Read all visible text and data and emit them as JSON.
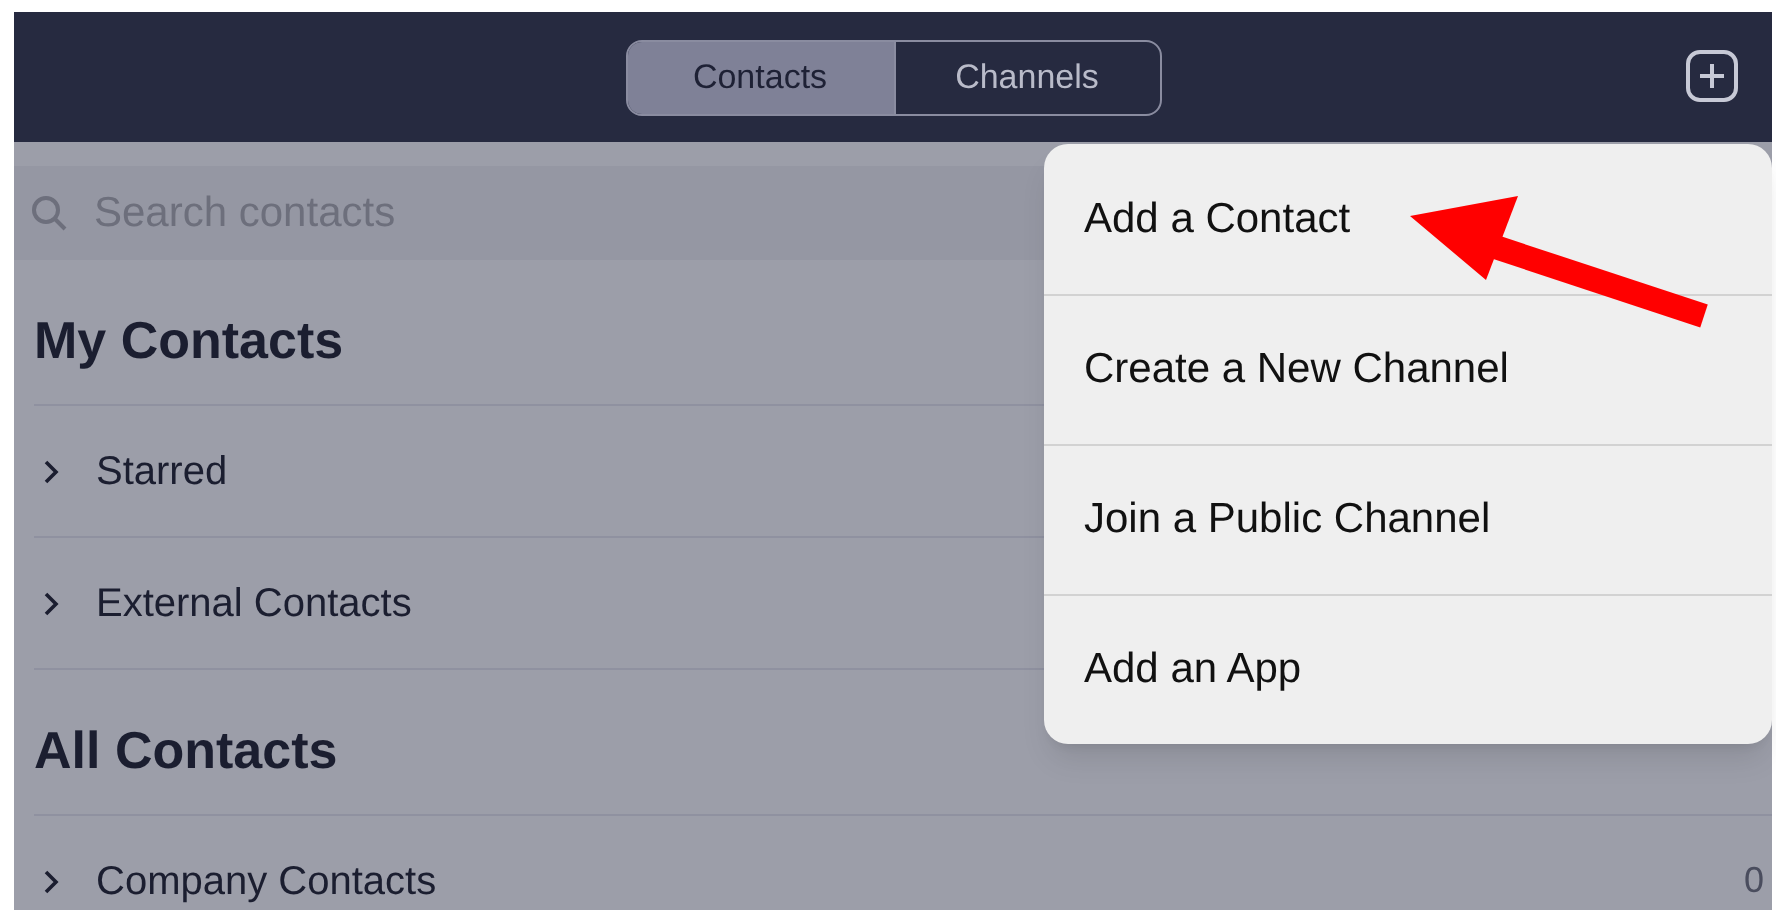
{
  "tabs": [
    {
      "label": "Contacts",
      "selected": true
    },
    {
      "label": "Channels",
      "selected": false
    }
  ],
  "search": {
    "placeholder": "Search contacts"
  },
  "sections": [
    {
      "title": "My Contacts",
      "groups": [
        {
          "label": "Starred"
        },
        {
          "label": "External Contacts"
        }
      ]
    },
    {
      "title": "All Contacts",
      "groups": [
        {
          "label": "Company Contacts",
          "count": "0"
        }
      ]
    }
  ],
  "menu": {
    "items": [
      "Add a Contact",
      "Create a New Channel",
      "Join a Public Channel",
      "Add an App"
    ]
  }
}
